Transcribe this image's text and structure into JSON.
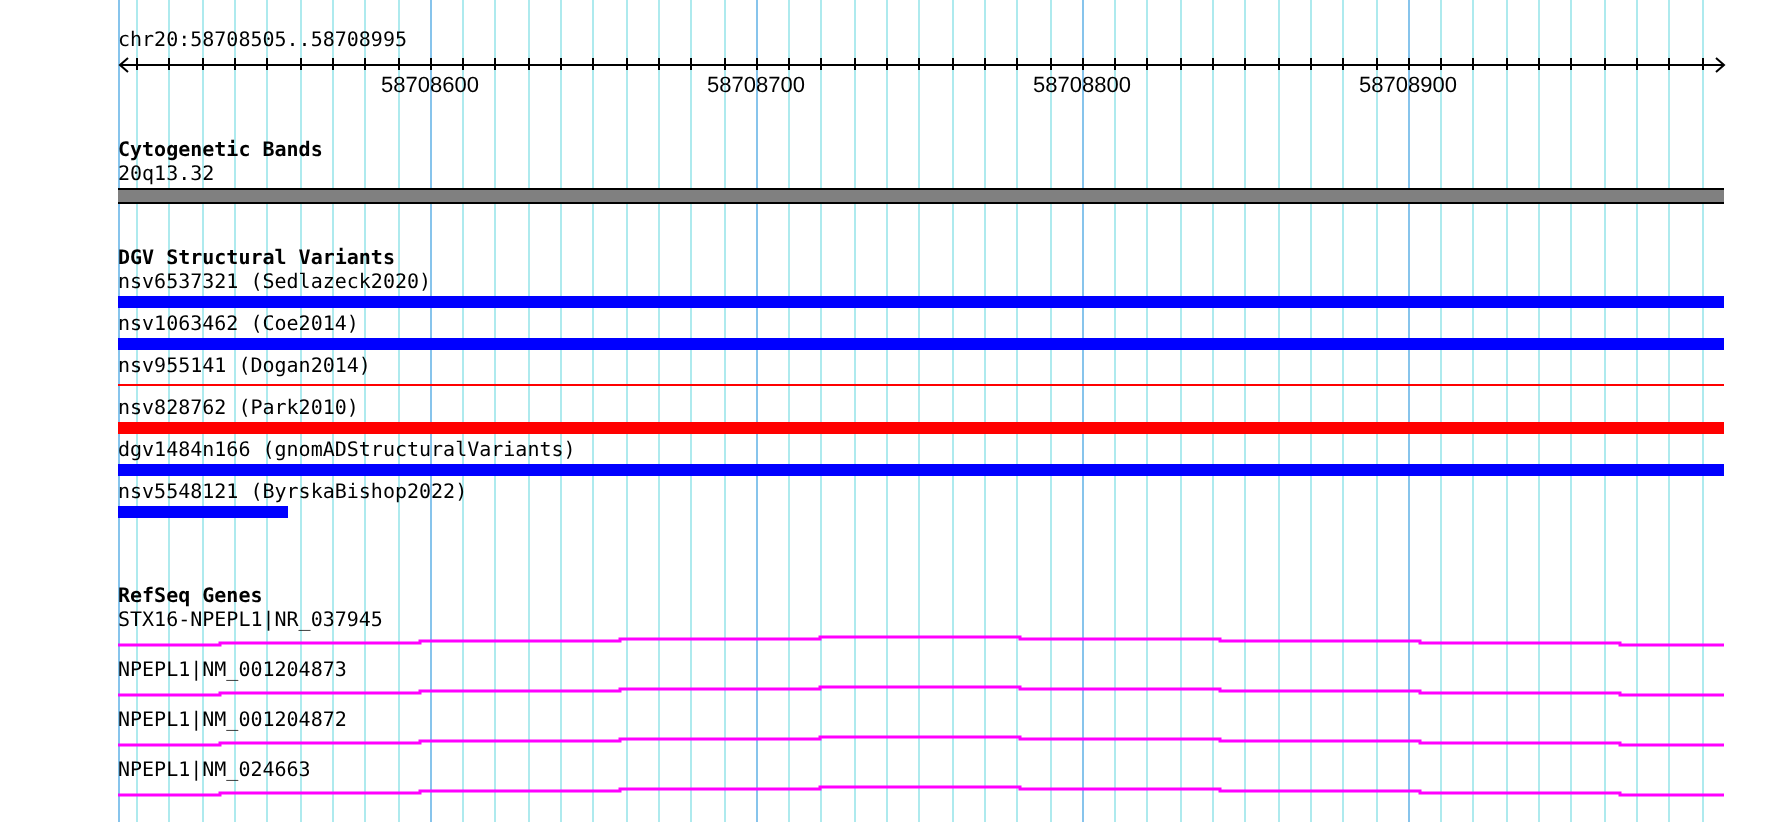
{
  "ruler": {
    "label": "chr20:58708505..58708995",
    "tick_labels": [
      "58708600",
      "58708700",
      "58708800",
      "58708900"
    ]
  },
  "tracks": [
    {
      "kind": "bands",
      "title": "Cytogenetic Bands",
      "features": [
        {
          "label": "20q13.32",
          "color": "#808080"
        }
      ]
    },
    {
      "kind": "variants",
      "title": "DGV Structural Variants",
      "features": [
        {
          "label": "nsv6537321 (Sedlazeck2020)",
          "kind": "thick",
          "color": "#0000ff"
        },
        {
          "label": "nsv1063462 (Coe2014)",
          "kind": "thick",
          "color": "#0000ff"
        },
        {
          "label": "nsv955141 (Dogan2014)",
          "kind": "thin",
          "color": "#ff0000"
        },
        {
          "label": "nsv828762 (Park2010)",
          "kind": "thick",
          "color": "#ff0000"
        },
        {
          "label": "dgv1484n166 (gnomADStructuralVariants)",
          "kind": "thick",
          "color": "#0000ff"
        },
        {
          "label": "nsv5548121 (ByrskaBishop2022)",
          "kind": "thick",
          "color": "#0000ff",
          "level": 0.106
        }
      ]
    },
    {
      "kind": "genes",
      "title": "RefSeq Genes",
      "features": [
        {
          "label": "STX16-NPEPL1|NR_037945"
        },
        {
          "label": "NPEPL1|NM_001204873"
        },
        {
          "label": "NPEPL1|NM_001204872"
        },
        {
          "label": "NPEPL1|NM_024663"
        }
      ]
    }
  ]
}
